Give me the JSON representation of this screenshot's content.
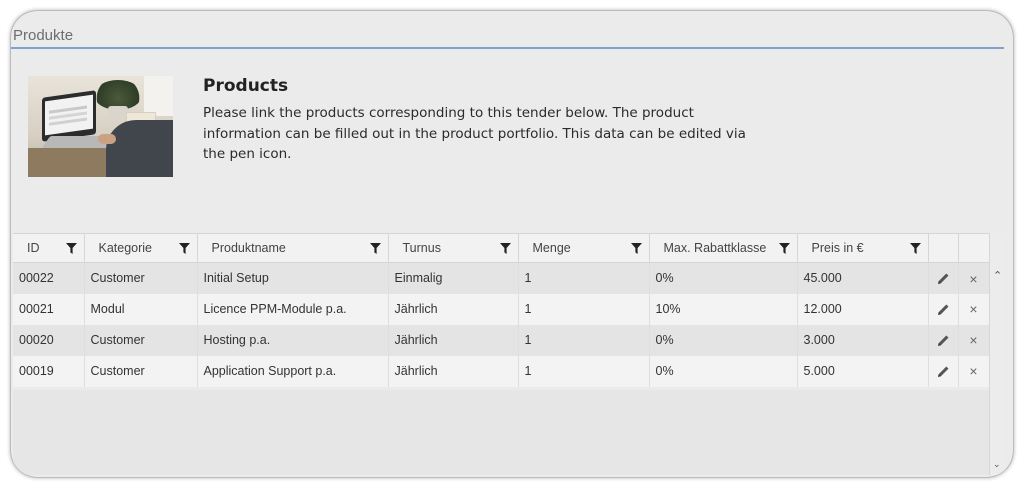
{
  "section": {
    "title": "Produkte"
  },
  "intro": {
    "heading": "Products",
    "text_line1": "Please link the products corresponding to this tender below. The product",
    "text_line2": "information can be filled out in the product portfolio. This data can be edited via",
    "text_line3": "the pen icon."
  },
  "table": {
    "columns": [
      "ID",
      "Kategorie",
      "Produktname",
      "Turnus",
      "Menge",
      "Max. Rabattklasse",
      "Preis in €"
    ],
    "rows": [
      {
        "id": "00022",
        "kategorie": "Customer",
        "produktname": "Initial Setup",
        "turnus": "Einmalig",
        "menge": "1",
        "rabatt": "0%",
        "preis": "45.000"
      },
      {
        "id": "00021",
        "kategorie": "Modul",
        "produktname": "Licence PPM-Module p.a.",
        "turnus": "Jährlich",
        "menge": "1",
        "rabatt": "10%",
        "preis": "12.000"
      },
      {
        "id": "00020",
        "kategorie": "Customer",
        "produktname": "Hosting p.a.",
        "turnus": "Jährlich",
        "menge": "1",
        "rabatt": "0%",
        "preis": "3.000"
      },
      {
        "id": "00019",
        "kategorie": "Customer",
        "produktname": "Application Support p.a.",
        "turnus": "Jährlich",
        "menge": "1",
        "rabatt": "0%",
        "preis": "5.000"
      }
    ],
    "row_actions": {
      "edit_icon": "pen-icon",
      "delete_icon": "close-icon",
      "delete_glyph": "×"
    }
  },
  "colors": {
    "accent_line": "#7ea4cc",
    "background": "#ebebeb"
  }
}
